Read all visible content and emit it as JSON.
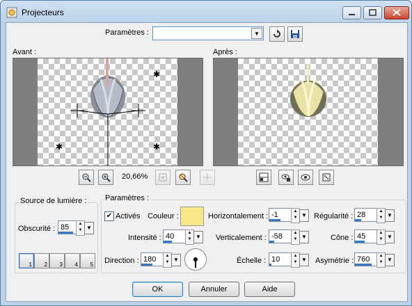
{
  "window": {
    "title": "Projecteurs"
  },
  "presets": {
    "label": "Paramètres :",
    "value": ""
  },
  "before": {
    "label": "Avant :"
  },
  "after": {
    "label": "Après :"
  },
  "zoom": {
    "level": "20,66%"
  },
  "light_source": {
    "group_label": "Source de lumière :",
    "darkness_label": "Obscurité :",
    "darkness_value": "85",
    "lights": [
      "1",
      "2",
      "3",
      "4",
      "5"
    ]
  },
  "params": {
    "group_label": "Paramètres :",
    "active_label": "Activés",
    "active_checked": true,
    "color_label": "Couleur :",
    "color_value": "#f7e98a",
    "horizontal_label": "Horizontalement :",
    "horizontal_value": "-1",
    "regularity_label": "Régularité :",
    "regularity_value": "28",
    "intensity_label": "Intensité :",
    "intensity_value": "40",
    "vertical_label": "Verticalement :",
    "vertical_value": "-58",
    "cone_label": "Cône :",
    "cone_value": "45",
    "direction_label": "Direction :",
    "direction_value": "180",
    "scale_label": "Échelle :",
    "scale_value": "10",
    "asymmetry_label": "Asymétrie :",
    "asymmetry_value": "760"
  },
  "buttons": {
    "ok": "OK",
    "cancel": "Annuler",
    "help": "Aide"
  }
}
